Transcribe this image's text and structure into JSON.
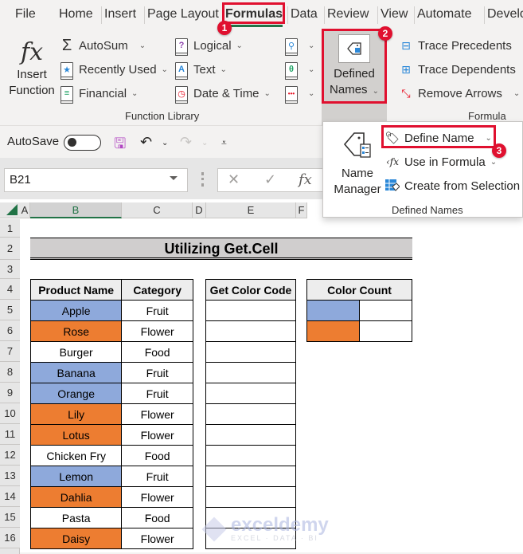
{
  "tabs": [
    {
      "label": "File"
    },
    {
      "label": "Home"
    },
    {
      "label": "Insert"
    },
    {
      "label": "Page Layout"
    },
    {
      "label": "Formulas",
      "active": true
    },
    {
      "label": "Data"
    },
    {
      "label": "Review"
    },
    {
      "label": "View"
    },
    {
      "label": "Automate"
    },
    {
      "label": "Develo"
    }
  ],
  "annotations": {
    "step1": "1",
    "step2": "2",
    "step3": "3",
    "highlight_color": "#e0102f"
  },
  "ribbon": {
    "insert_function": {
      "icon": "fx",
      "line1": "Insert",
      "line2": "Function"
    },
    "function_library": {
      "label": "Function Library",
      "autosum": "AutoSum",
      "recently_used": "Recently Used",
      "financial": "Financial",
      "logical": "Logical",
      "text": "Text",
      "date_time": "Date & Time"
    },
    "defined_names_button": {
      "line1": "Defined",
      "line2": "Names"
    },
    "formula_auditing": {
      "label": "Formula Aud",
      "trace_precedents": "Trace Precedents",
      "trace_dependents": "Trace Dependents",
      "remove_arrows": "Remove Arrows"
    }
  },
  "dropdown": {
    "name_manager": {
      "line1": "Name",
      "line2": "Manager"
    },
    "define_name": "Define Name",
    "use_in_formula": "Use in Formula",
    "create_from_selection": "Create from Selection",
    "group_label": "Defined Names"
  },
  "qat": {
    "autosave": "AutoSave",
    "autosave_on": false
  },
  "formula_bar": {
    "name_box": "B21",
    "fx": "fx",
    "cancel": "✕",
    "enter": "✓",
    "formula": ""
  },
  "columns": [
    "A",
    "B",
    "C",
    "D",
    "E",
    "F"
  ],
  "rows": [
    "1",
    "2",
    "3",
    "4",
    "5",
    "6",
    "7",
    "8",
    "9",
    "10",
    "11",
    "12",
    "13",
    "14",
    "15",
    "16"
  ],
  "sheet": {
    "title": "Utilizing Get.Cell",
    "colors": {
      "blue": "#8ea9db",
      "orange": "#ed7d31"
    },
    "product_table": {
      "headers": [
        "Product Name",
        "Category"
      ],
      "rows": [
        {
          "name": "Apple",
          "category": "Fruit",
          "fill": "blue"
        },
        {
          "name": "Rose",
          "category": "Flower",
          "fill": "orange"
        },
        {
          "name": "Burger",
          "category": "Food",
          "fill": "none"
        },
        {
          "name": "Banana",
          "category": "Fruit",
          "fill": "blue"
        },
        {
          "name": "Orange",
          "category": "Fruit",
          "fill": "blue"
        },
        {
          "name": "Lily",
          "category": "Flower",
          "fill": "orange"
        },
        {
          "name": "Lotus",
          "category": "Flower",
          "fill": "orange"
        },
        {
          "name": "Chicken Fry",
          "category": "Food",
          "fill": "none"
        },
        {
          "name": "Lemon",
          "category": "Fruit",
          "fill": "blue"
        },
        {
          "name": "Dahlia",
          "category": "Flower",
          "fill": "orange"
        },
        {
          "name": "Pasta",
          "category": "Food",
          "fill": "none"
        },
        {
          "name": "Daisy",
          "category": "Flower",
          "fill": "orange"
        }
      ]
    },
    "color_code_table": {
      "header": "Get Color Code",
      "values": [
        "",
        "",
        "",
        "",
        "",
        "",
        "",
        "",
        "",
        "",
        "",
        ""
      ]
    },
    "color_count_table": {
      "header": "Color Count",
      "rows": [
        {
          "fill": "blue",
          "count": ""
        },
        {
          "fill": "orange",
          "count": ""
        }
      ]
    }
  },
  "watermark": {
    "brand": "exceldemy",
    "tagline": "EXCEL · DATA · BI"
  }
}
